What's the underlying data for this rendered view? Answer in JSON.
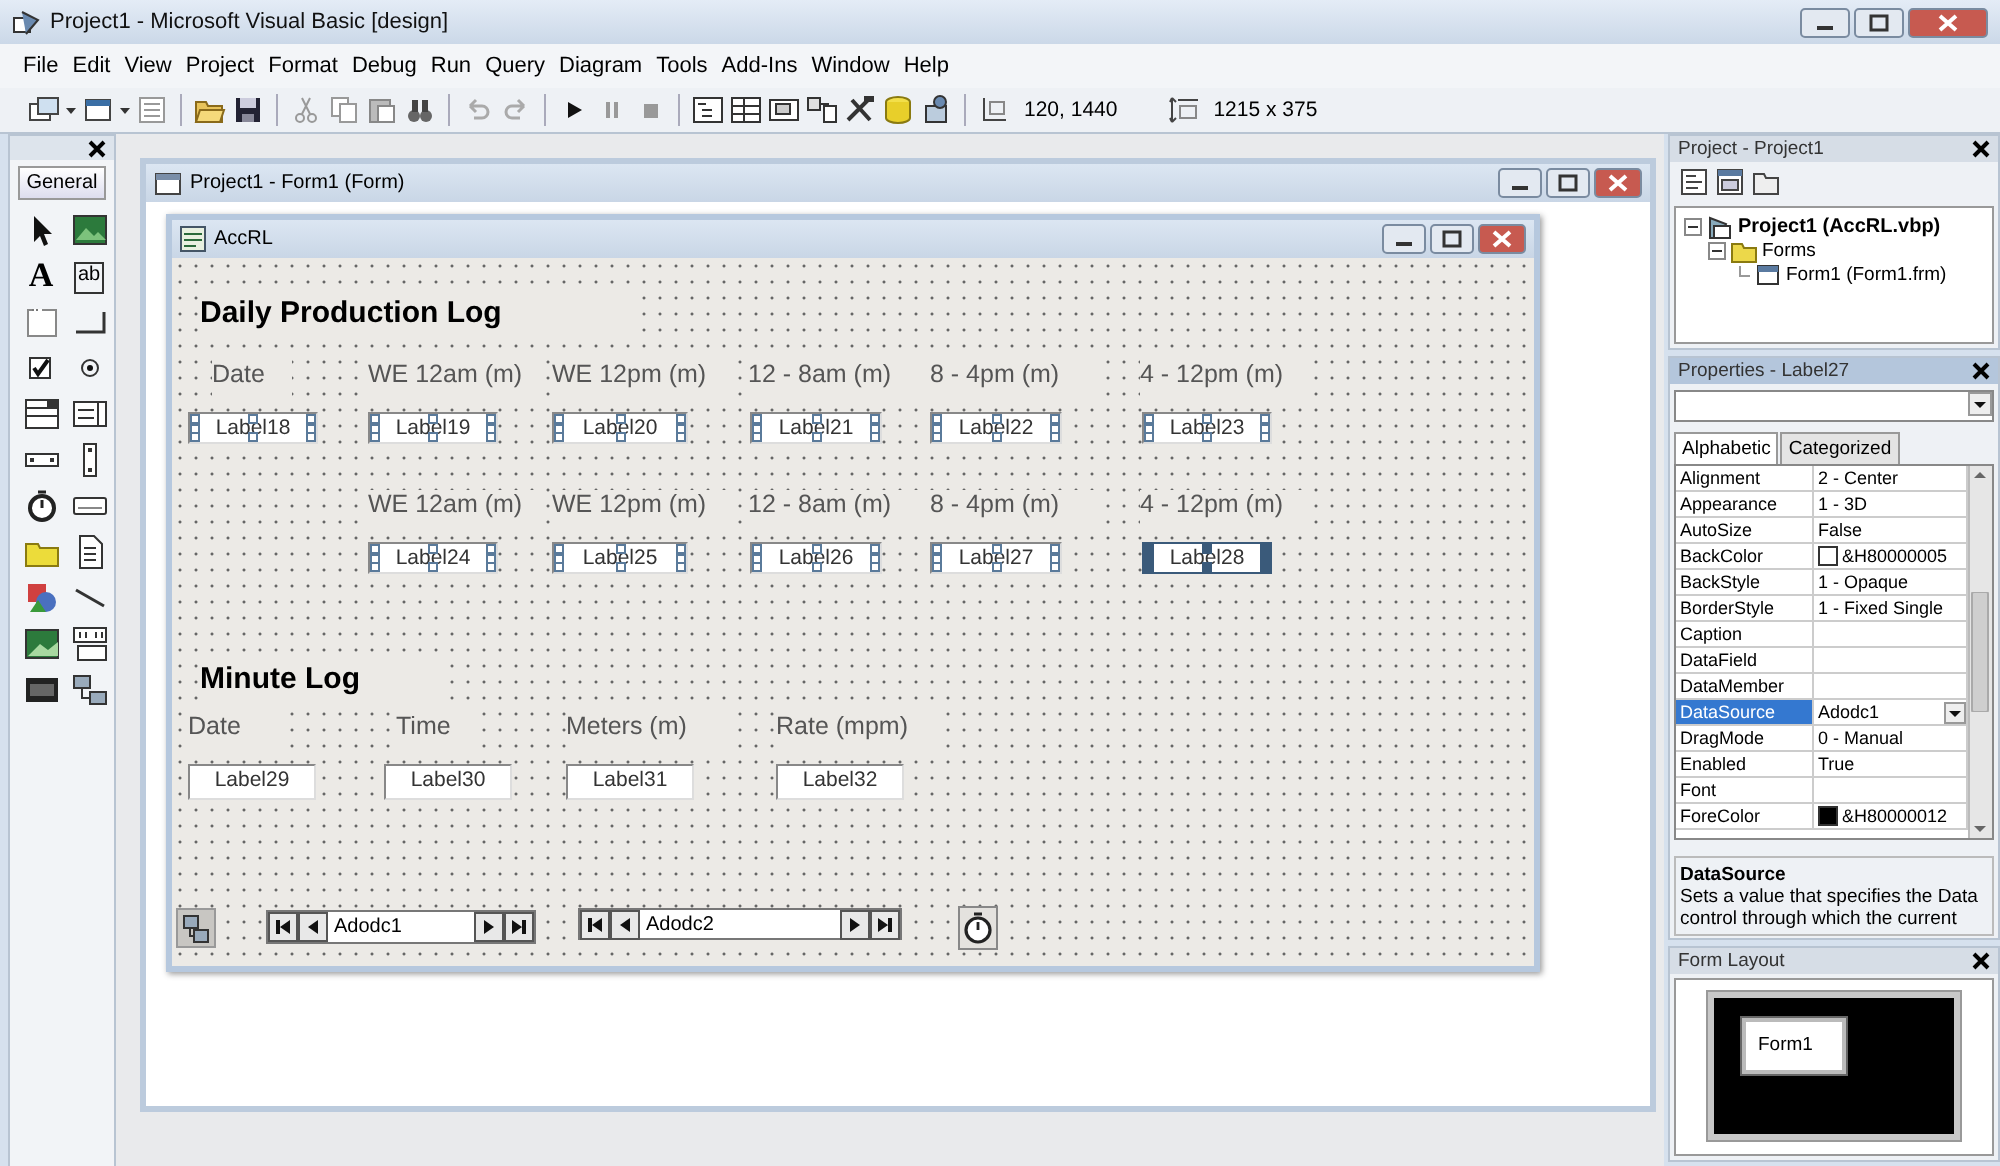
{
  "window": {
    "title": "Project1 - Microsoft Visual Basic [design]"
  },
  "menu": [
    "File",
    "Edit",
    "View",
    "Project",
    "Format",
    "Debug",
    "Run",
    "Query",
    "Diagram",
    "Tools",
    "Add-Ins",
    "Window",
    "Help"
  ],
  "toolbar": {
    "position": "120, 1440",
    "size": "1215 x 375"
  },
  "toolbox": {
    "title": "General",
    "label_tool": "A",
    "textbox_tool": "ab"
  },
  "designer": {
    "title": "Project1 - Form1 (Form)",
    "form": {
      "title": "AccRL",
      "controls": [
        {
          "kind": "heading",
          "text": "Daily Production Log"
        },
        {
          "kind": "caption",
          "text": "Date"
        },
        {
          "kind": "caption",
          "text": "WE 12am (m)"
        },
        {
          "kind": "caption",
          "text": "WE 12pm (m)"
        },
        {
          "kind": "caption",
          "text": "12 - 8am (m)"
        },
        {
          "kind": "caption",
          "text": "8 - 4pm (m)"
        },
        {
          "kind": "caption",
          "text": "4 - 12pm (m)"
        },
        {
          "kind": "field",
          "text": "Label18",
          "selected": true,
          "primary": false
        },
        {
          "kind": "field",
          "text": "Label19",
          "selected": true,
          "primary": false
        },
        {
          "kind": "field",
          "text": "Label20",
          "selected": true,
          "primary": false
        },
        {
          "kind": "field",
          "text": "Label21",
          "selected": true,
          "primary": false
        },
        {
          "kind": "field",
          "text": "Label22",
          "selected": true,
          "primary": false
        },
        {
          "kind": "field",
          "text": "Label23",
          "selected": true,
          "primary": false
        },
        {
          "kind": "caption",
          "text": "WE 12am (m)"
        },
        {
          "kind": "caption",
          "text": "WE 12pm (m)"
        },
        {
          "kind": "caption",
          "text": "12 - 8am (m)"
        },
        {
          "kind": "caption",
          "text": "8 - 4pm (m)"
        },
        {
          "kind": "caption",
          "text": "4 - 12pm (m)"
        },
        {
          "kind": "field",
          "text": "Label24",
          "selected": true,
          "primary": false
        },
        {
          "kind": "field",
          "text": "Label25",
          "selected": true,
          "primary": false
        },
        {
          "kind": "field",
          "text": "Label26",
          "selected": true,
          "primary": false
        },
        {
          "kind": "field",
          "text": "Label27",
          "selected": true,
          "primary": false
        },
        {
          "kind": "field",
          "text": "Label28",
          "selected": true,
          "primary": true
        },
        {
          "kind": "heading",
          "text": "Minute Log"
        },
        {
          "kind": "caption",
          "text": "Date"
        },
        {
          "kind": "caption",
          "text": "Time"
        },
        {
          "kind": "caption",
          "text": "Meters (m)"
        },
        {
          "kind": "caption",
          "text": "Rate (mpm)"
        },
        {
          "kind": "field",
          "text": "Label29",
          "selected": false,
          "primary": false
        },
        {
          "kind": "field",
          "text": "Label30",
          "selected": false,
          "primary": false
        },
        {
          "kind": "field",
          "text": "Label31",
          "selected": false,
          "primary": false
        },
        {
          "kind": "field",
          "text": "Label32",
          "selected": false,
          "primary": false
        },
        {
          "kind": "data-environment"
        },
        {
          "kind": "adodc",
          "text": "Adodc1"
        },
        {
          "kind": "adodc",
          "text": "Adodc2"
        },
        {
          "kind": "timer"
        }
      ]
    }
  },
  "project": {
    "title": "Project - Project1",
    "tree": [
      {
        "label": "Project1 (AccRL.vbp)",
        "expanded": true,
        "children": [
          {
            "label": "Forms",
            "expanded": true,
            "children": [
              {
                "label": "Form1 (Form1.frm)"
              }
            ]
          }
        ]
      }
    ]
  },
  "properties": {
    "title": "Properties - Label27",
    "tabs": [
      {
        "label": "Alphabetic",
        "selected": true
      },
      {
        "label": "Categorized",
        "selected": false
      }
    ],
    "rows": [
      {
        "name": "Alignment",
        "value": "2 - Center",
        "kind": "text",
        "selected": false
      },
      {
        "name": "Appearance",
        "value": "1 - 3D",
        "kind": "text",
        "selected": false
      },
      {
        "name": "AutoSize",
        "value": "False",
        "kind": "text",
        "selected": false
      },
      {
        "name": "BackColor",
        "value": "&H80000005",
        "kind": "color",
        "color": "#ffffff",
        "selected": false
      },
      {
        "name": "BackStyle",
        "value": "1 - Opaque",
        "kind": "text",
        "selected": false
      },
      {
        "name": "BorderStyle",
        "value": "1 - Fixed Single",
        "kind": "text",
        "selected": false
      },
      {
        "name": "Caption",
        "kind": "text",
        "selected": false
      },
      {
        "name": "DataField",
        "kind": "text",
        "selected": false
      },
      {
        "name": "DataMember",
        "kind": "text",
        "selected": false
      },
      {
        "name": "DataSource",
        "value": "Adodc1",
        "kind": "dropdown",
        "selected": true
      },
      {
        "name": "DragMode",
        "value": "0 - Manual",
        "kind": "text",
        "selected": false
      },
      {
        "name": "Enabled",
        "value": "True",
        "kind": "text",
        "selected": false
      },
      {
        "name": "Font",
        "kind": "text",
        "selected": false
      },
      {
        "name": "ForeColor",
        "value": "&H80000012",
        "kind": "color",
        "color": "#000000",
        "selected": false
      }
    ],
    "description": {
      "title": "DataSource",
      "text": "Sets a value that specifies the Data control through which the current"
    }
  },
  "form_layout": {
    "title": "Form Layout",
    "form": "Form1"
  }
}
